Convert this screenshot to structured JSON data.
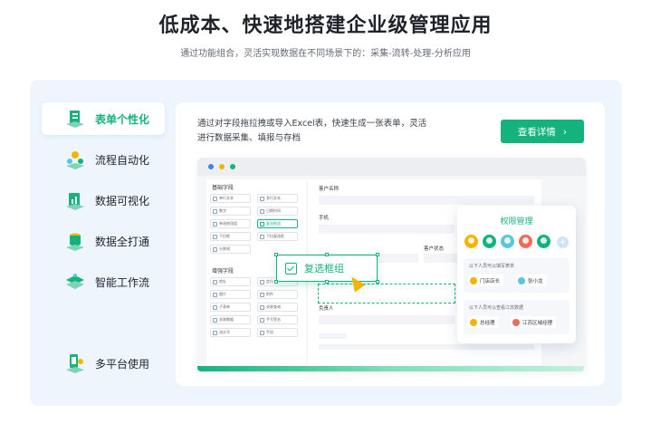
{
  "header": {
    "title": "低成本、快速地搭建企业级管理应用",
    "subtitle": "通过功能组合，灵活实现数据在不同场景下的：采集-流转-处理-分析应用"
  },
  "nav": {
    "items": [
      {
        "label": "表单个性化",
        "icon": "form-icon",
        "active": true
      },
      {
        "label": "流程自动化",
        "icon": "workflow-icon",
        "active": false
      },
      {
        "label": "数据可视化",
        "icon": "chart-icon",
        "active": false
      },
      {
        "label": "数据全打通",
        "icon": "database-icon",
        "active": false
      },
      {
        "label": "智能工作流",
        "icon": "layers-icon",
        "active": false
      },
      {
        "label": "多平台使用",
        "icon": "devices-icon",
        "active": false
      }
    ]
  },
  "content": {
    "description": "通过对字段拖拉拽或导入Excel表，快速生成一张表单，灵活进行数据采集、填报与存档",
    "detail_button": "查看详情",
    "detail_chevron": "›"
  },
  "mock": {
    "basic_fields_title": "基础字段",
    "advanced_fields_title": "增强字段",
    "basic_fields": [
      "单行文本",
      "多行文本",
      "数字",
      "日期时间",
      "单选按钮组",
      "复选框组",
      "下拉框",
      "下拉复选框",
      "分割线"
    ],
    "highlighted_field": "复选框组",
    "advanced_fields": [
      "地址",
      "定位",
      "图片",
      "附件",
      "子表单",
      "关联查询",
      "关联数据",
      "手写签名",
      "流水号",
      "手机"
    ],
    "form_labels": {
      "customer_name": "客户名称",
      "phone": "手机",
      "customer_status": "客户状态",
      "owner": "负责人"
    },
    "floating_widget": "复选框组"
  },
  "permissions": {
    "title": "权限管理",
    "avatar_colors": [
      "#f5b400",
      "#14b37d",
      "#57c7e3",
      "#f06a5a",
      "#14b37d"
    ],
    "plus": "+",
    "section1_label": "以下人员可以填写表单",
    "section1_users": [
      {
        "name": "门店店长",
        "color": "#f5b400"
      },
      {
        "name": "张小龙",
        "color": "#57c7e3"
      }
    ],
    "section2_label": "以下人员可以查看江苏数据",
    "section2_users": [
      {
        "name": "总经理",
        "color": "#f5b400"
      },
      {
        "name": "江苏区域经理",
        "color": "#f06a5a"
      }
    ]
  },
  "colors": {
    "accent": "#14b37d",
    "panel_bg": "#eef5fd",
    "window_dot_blue": "#3b82f6",
    "window_dot_yellow": "#f5b400",
    "window_dot_green": "#14b37d"
  }
}
